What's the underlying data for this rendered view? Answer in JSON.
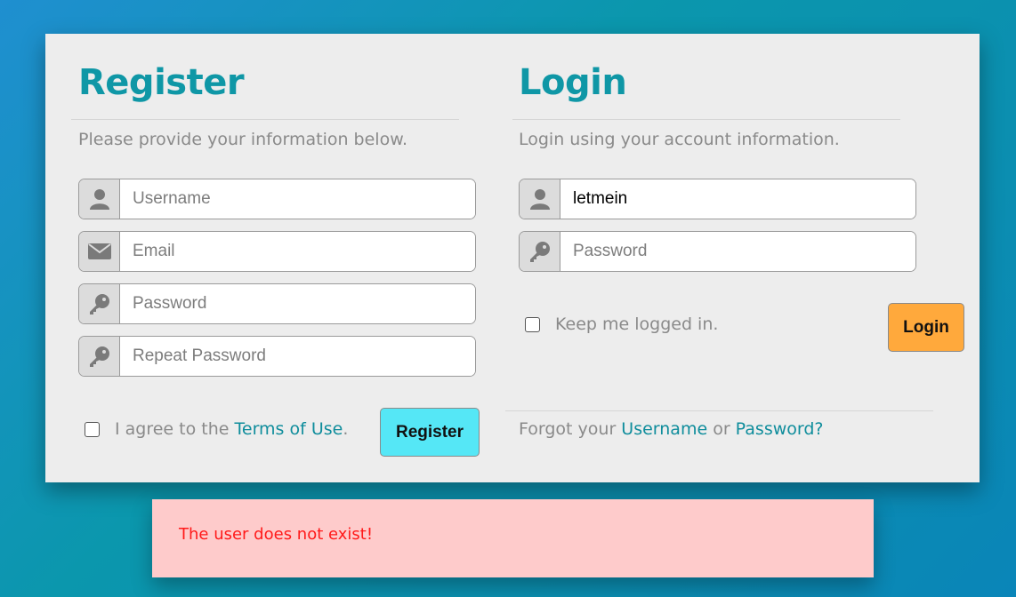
{
  "register": {
    "title": "Register",
    "subtitle": "Please provide your information below.",
    "fields": [
      {
        "icon": "user-icon",
        "placeholder": "Username",
        "value": ""
      },
      {
        "icon": "envelope-icon",
        "placeholder": "Email",
        "value": ""
      },
      {
        "icon": "key-icon",
        "placeholder": "Password",
        "value": ""
      },
      {
        "icon": "key-icon",
        "placeholder": "Repeat Password",
        "value": ""
      }
    ],
    "agree_prefix": "I agree to the ",
    "agree_link": "Terms of Use",
    "agree_suffix": ".",
    "button_label": "Register"
  },
  "login": {
    "title": "Login",
    "subtitle": "Login using your account information.",
    "fields": [
      {
        "icon": "user-icon",
        "placeholder": "",
        "value": "letmein"
      },
      {
        "icon": "key-icon",
        "placeholder": "Password",
        "value": ""
      }
    ],
    "keep_label": "Keep me logged in.",
    "button_label": "Login",
    "forgot_prefix": "Forgot your ",
    "forgot_username": "Username",
    "forgot_or": " or ",
    "forgot_password": "Password?"
  },
  "alert": {
    "message": "The user does not exist!"
  },
  "colors": {
    "accent": "#0f97a6",
    "register_button": "#55e7f6",
    "login_button": "#ffa93c",
    "alert_bg": "#fecbcb",
    "alert_text": "#ff1a1a"
  }
}
